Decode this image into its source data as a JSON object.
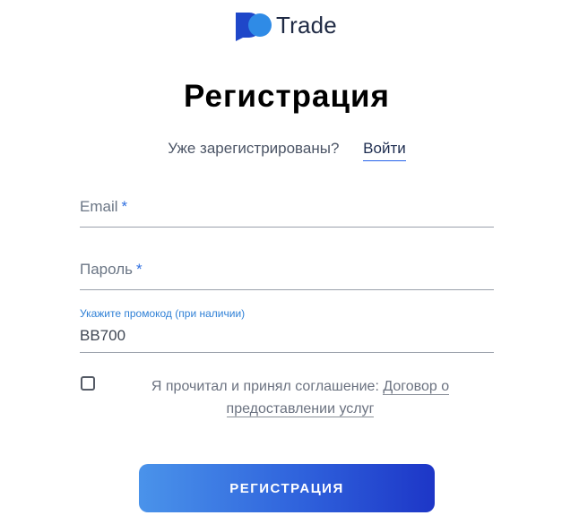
{
  "logo": {
    "text": "Trade",
    "icon": "logo-mark-icon",
    "colors": {
      "dark": "#1f47c9",
      "light": "#2f8be6"
    }
  },
  "title": "Регистрация",
  "login_prompt": {
    "question": "Уже зарегистрированы?",
    "link": "Войти"
  },
  "form": {
    "email": {
      "label": "Email",
      "required_mark": "*",
      "value": ""
    },
    "password": {
      "label": "Пароль",
      "required_mark": "*",
      "value": ""
    },
    "promo": {
      "caption": "Укажите промокод (при наличии)",
      "value": "BB700"
    }
  },
  "agreement": {
    "checked": false,
    "text": "Я прочитал и принял соглашение:",
    "link": "Договор о предоставлении услуг"
  },
  "register_button": {
    "label": "РЕГИСТРАЦИЯ",
    "gradient": [
      "#4a93ea",
      "#1d36c7"
    ]
  }
}
